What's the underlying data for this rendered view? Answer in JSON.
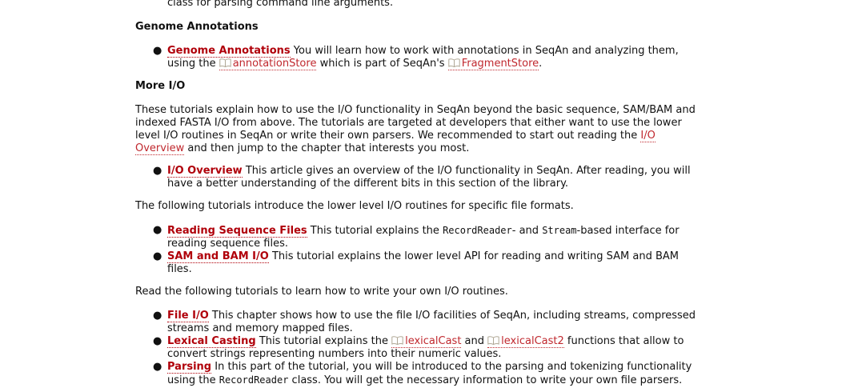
{
  "top_fragment": "class for parsing command line arguments.",
  "genome": {
    "heading": "Genome Annotations",
    "item": {
      "link": "Genome Annotations",
      "text1": " You will learn how to work with annotations in SeqAn and analyzing them,",
      "text2_pre": "using the ",
      "api1": "annotationStore",
      "text2_mid": " which is part of SeqAn's ",
      "api2": "FragmentStore",
      "text2_post": "."
    }
  },
  "more_io": {
    "heading": "More I/O",
    "intro": {
      "l1": "These tutorials explain how to use the I/O functionality in SeqAn beyond the basic sequence, SAM/BAM and",
      "l2": "indexed FASTA I/O from above. The tutorials are targeted at developers that either want to use the lower",
      "l3_pre": "level I/O routines in SeqAn or write their own parsers. We recommended to start out reading the ",
      "l3_link": "I/O",
      "l4_link": "Overview",
      "l4_post": " and then jump to the chapter that interests you most."
    },
    "overview_item": {
      "link": "I/O Overview",
      "text1": " This article gives an overview of the I/O functionality in SeqAn. After reading, you will",
      "text2": "have a better understanding of the different bits in this section of the library."
    },
    "following": "The following tutorials introduce the lower level I/O routines for specific file formats.",
    "format_items": [
      {
        "link": "Reading Sequence Files",
        "text_pre": " This tutorial explains the ",
        "code1": "RecordReader",
        "text_mid": "- and ",
        "code2": "Stream",
        "text_post": "-based interface for",
        "text2": "reading sequence files."
      },
      {
        "link": "SAM and BAM I/O",
        "text1": " This tutorial explains the lower level API for reading and writing SAM and BAM",
        "text2": "files."
      }
    ],
    "read_following": "Read the following tutorials to learn how to write your own I/O routines.",
    "routine_items": [
      {
        "link": "File I/O",
        "text1": " This chapter shows how to use the file I/O facilities of SeqAn, including streams, compressed",
        "text2": "streams and memory mapped files."
      },
      {
        "link": "Lexical Casting",
        "text_pre": " This tutorial explains the ",
        "api1": "lexicalCast",
        "text_mid": " and ",
        "api2": "lexicalCast2",
        "text_post": " functions that allow to",
        "text2": "convert strings representing numbers into their numeric values."
      },
      {
        "link": "Parsing",
        "text1": " In this part of the tutorial, you will be introduced to the parsing and tokenizing functionality",
        "text2_pre": "using the ",
        "code1": "RecordReader",
        "text2_post": " class. You will get the necessary information to write your own file parsers."
      }
    ]
  },
  "colors": {
    "tutorial_link": "#b0000a",
    "api_link": "#c0282e",
    "text": "#111111"
  },
  "icons": {
    "api_ref": "open-book-icon",
    "bullet": "disc-bullet"
  }
}
